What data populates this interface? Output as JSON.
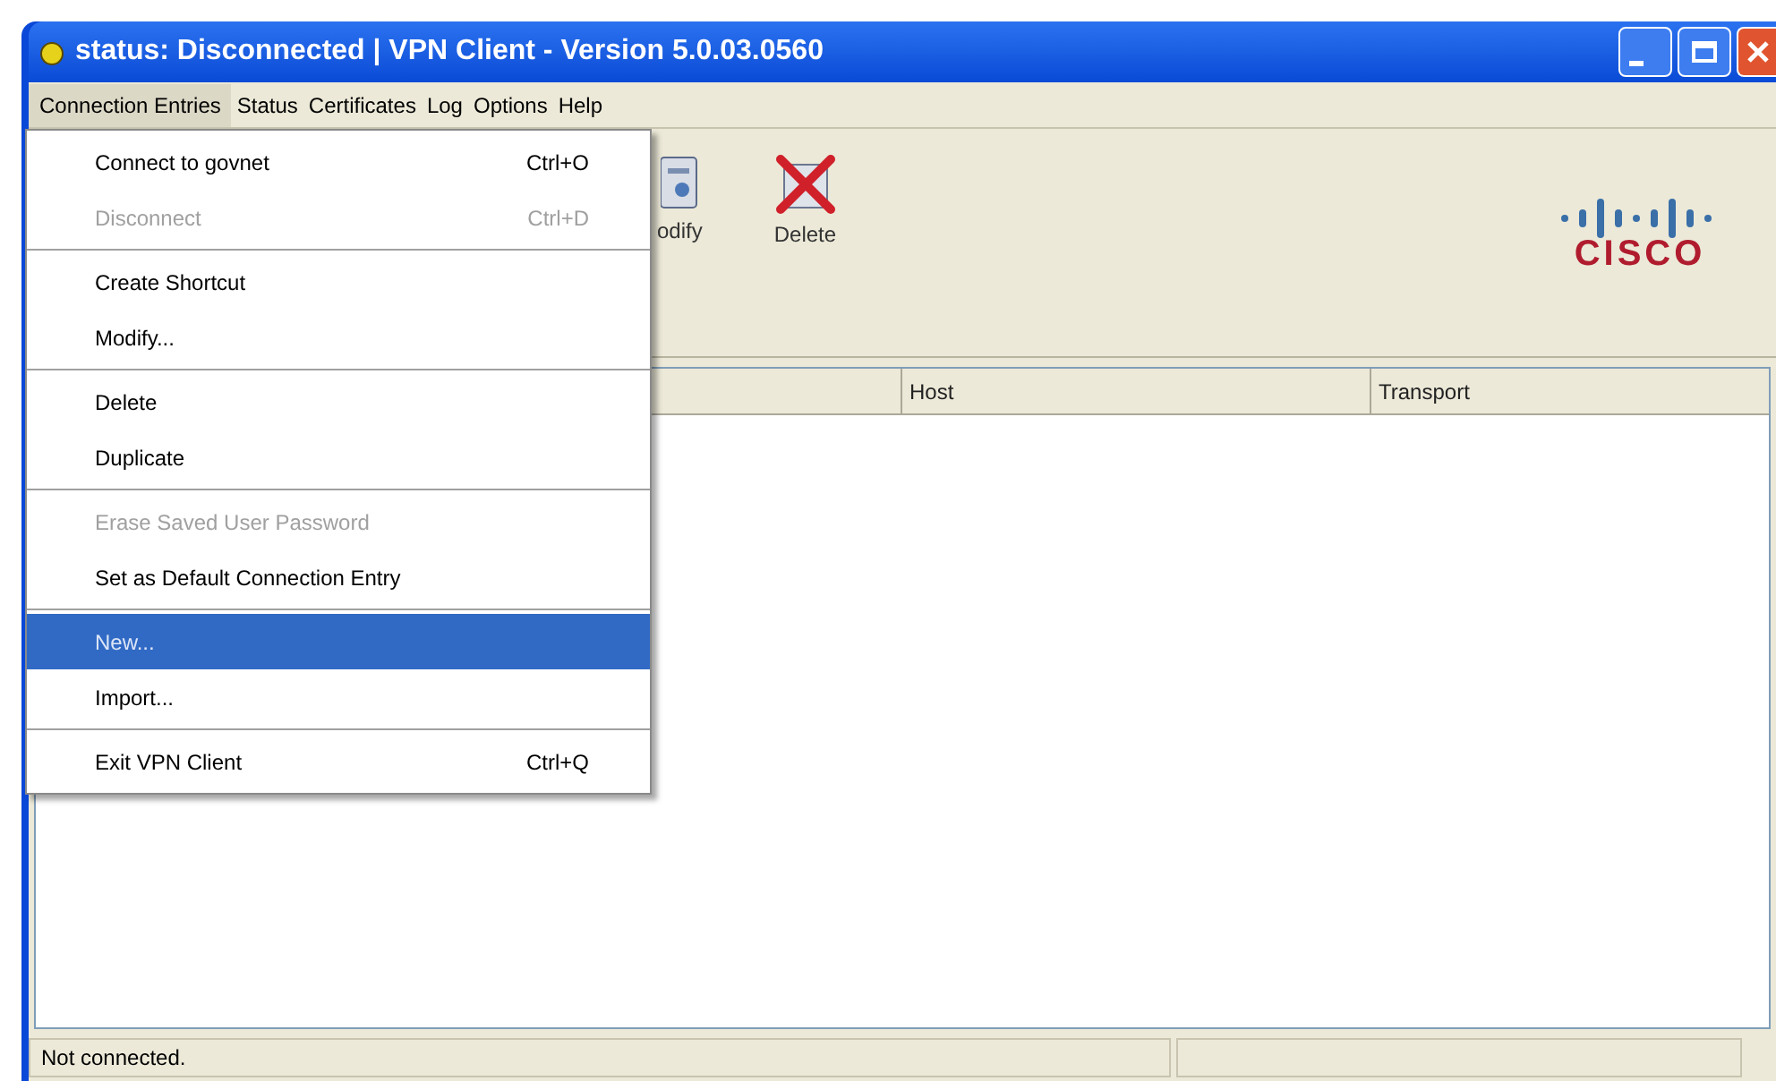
{
  "window": {
    "title": "status: Disconnected | VPN Client - Version 5.0.03.0560"
  },
  "menu_bar": [
    {
      "label": "Connection Entries",
      "selected": true
    },
    {
      "label": "Status",
      "selected": false
    },
    {
      "label": "Certificates",
      "selected": false
    },
    {
      "label": "Log",
      "selected": false
    },
    {
      "label": "Options",
      "selected": false
    },
    {
      "label": "Help",
      "selected": false
    }
  ],
  "dropdown_menu": [
    {
      "label": "Connect to govnet",
      "shortcut": "Ctrl+O",
      "disabled": false,
      "selected": false,
      "separator_after": false
    },
    {
      "label": "Disconnect",
      "shortcut": "Ctrl+D",
      "disabled": true,
      "selected": false,
      "separator_after": true
    },
    {
      "label": "Create Shortcut",
      "disabled": false,
      "selected": false,
      "separator_after": false
    },
    {
      "label": "Modify...",
      "disabled": false,
      "selected": false,
      "separator_after": true
    },
    {
      "label": "Delete",
      "disabled": false,
      "selected": false,
      "separator_after": false
    },
    {
      "label": "Duplicate",
      "disabled": false,
      "selected": false,
      "separator_after": true
    },
    {
      "label": "Erase Saved User Password",
      "disabled": true,
      "selected": false,
      "separator_after": false
    },
    {
      "label": "Set as Default Connection Entry",
      "disabled": false,
      "selected": false,
      "separator_after": true
    },
    {
      "label": "New...",
      "disabled": false,
      "selected": true,
      "separator_after": false
    },
    {
      "label": "Import...",
      "disabled": false,
      "selected": false,
      "separator_after": true
    },
    {
      "label": "Exit VPN Client",
      "shortcut": "Ctrl+Q",
      "disabled": false,
      "selected": false,
      "separator_after": false
    }
  ],
  "toolbar": [
    {
      "kind": "modify",
      "label": "odify"
    },
    {
      "kind": "delete",
      "label": "Delete"
    }
  ],
  "logo": {
    "text": "CISCO"
  },
  "table": {
    "columns": [
      "Host",
      "Transport"
    ]
  },
  "status_bar": {
    "message": "Not connected."
  }
}
